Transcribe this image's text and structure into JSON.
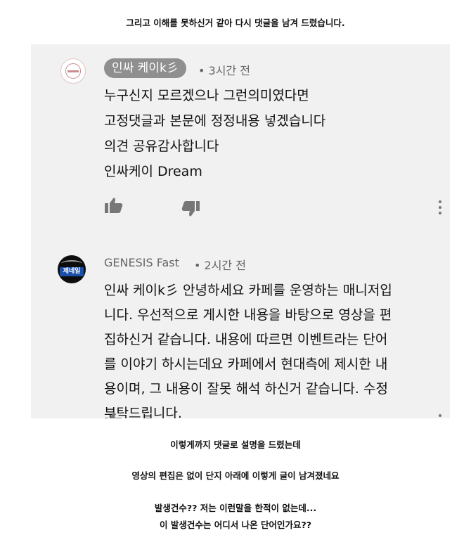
{
  "captions": {
    "top": "그리고 이해를 못하신거 같아 다시 댓글을 남겨 드렸습니다.",
    "bottom1": "이렇게까지 댓글로 설명을 드렸는데",
    "bottom2": "영상의 편집은 없이 단지 아래에 이렇게 글이 남겨졌네요",
    "bottom3": "발생건수?? 저는 이런말을 한적이 없는데...",
    "bottom4": "이 발생건수는 어디서 나온 단어인가요??"
  },
  "comments": [
    {
      "author": "인싸 케이k彡",
      "time": "• 3시간 전",
      "lines": [
        "누구신지 모르겠으나 그런의미였다면",
        "고정댓글과 본문에 정정내용 넣겠습니다",
        "의견 공유감사합니다",
        "인싸케이 Dream"
      ]
    },
    {
      "author": "GENESIS Fast",
      "time": "• 2시간 전",
      "avatar_text": "제네일",
      "lines": [
        "인싸 케이k彡 안녕하세요 카페를 운영하는 매니저입",
        "니다. 우선적으로 게시한 내용을 바탕으로 영상을 편",
        "집하신거 같습니다. 내용에 따르면 이벤트라는 단어",
        "를 이야기 하시는데요 카페에서 현대측에 제시한 내",
        "용이며,  그 내용이 잘못 해석 하신거 같습니다. 수정",
        "부탁드립니다."
      ]
    }
  ],
  "icons": [
    "like-icon",
    "dislike-icon",
    "more-options-icon"
  ],
  "colors": {
    "panel": "#f1f1f1",
    "chip": "#8f8f8f",
    "meta": "#666666",
    "icon": "#777777"
  }
}
